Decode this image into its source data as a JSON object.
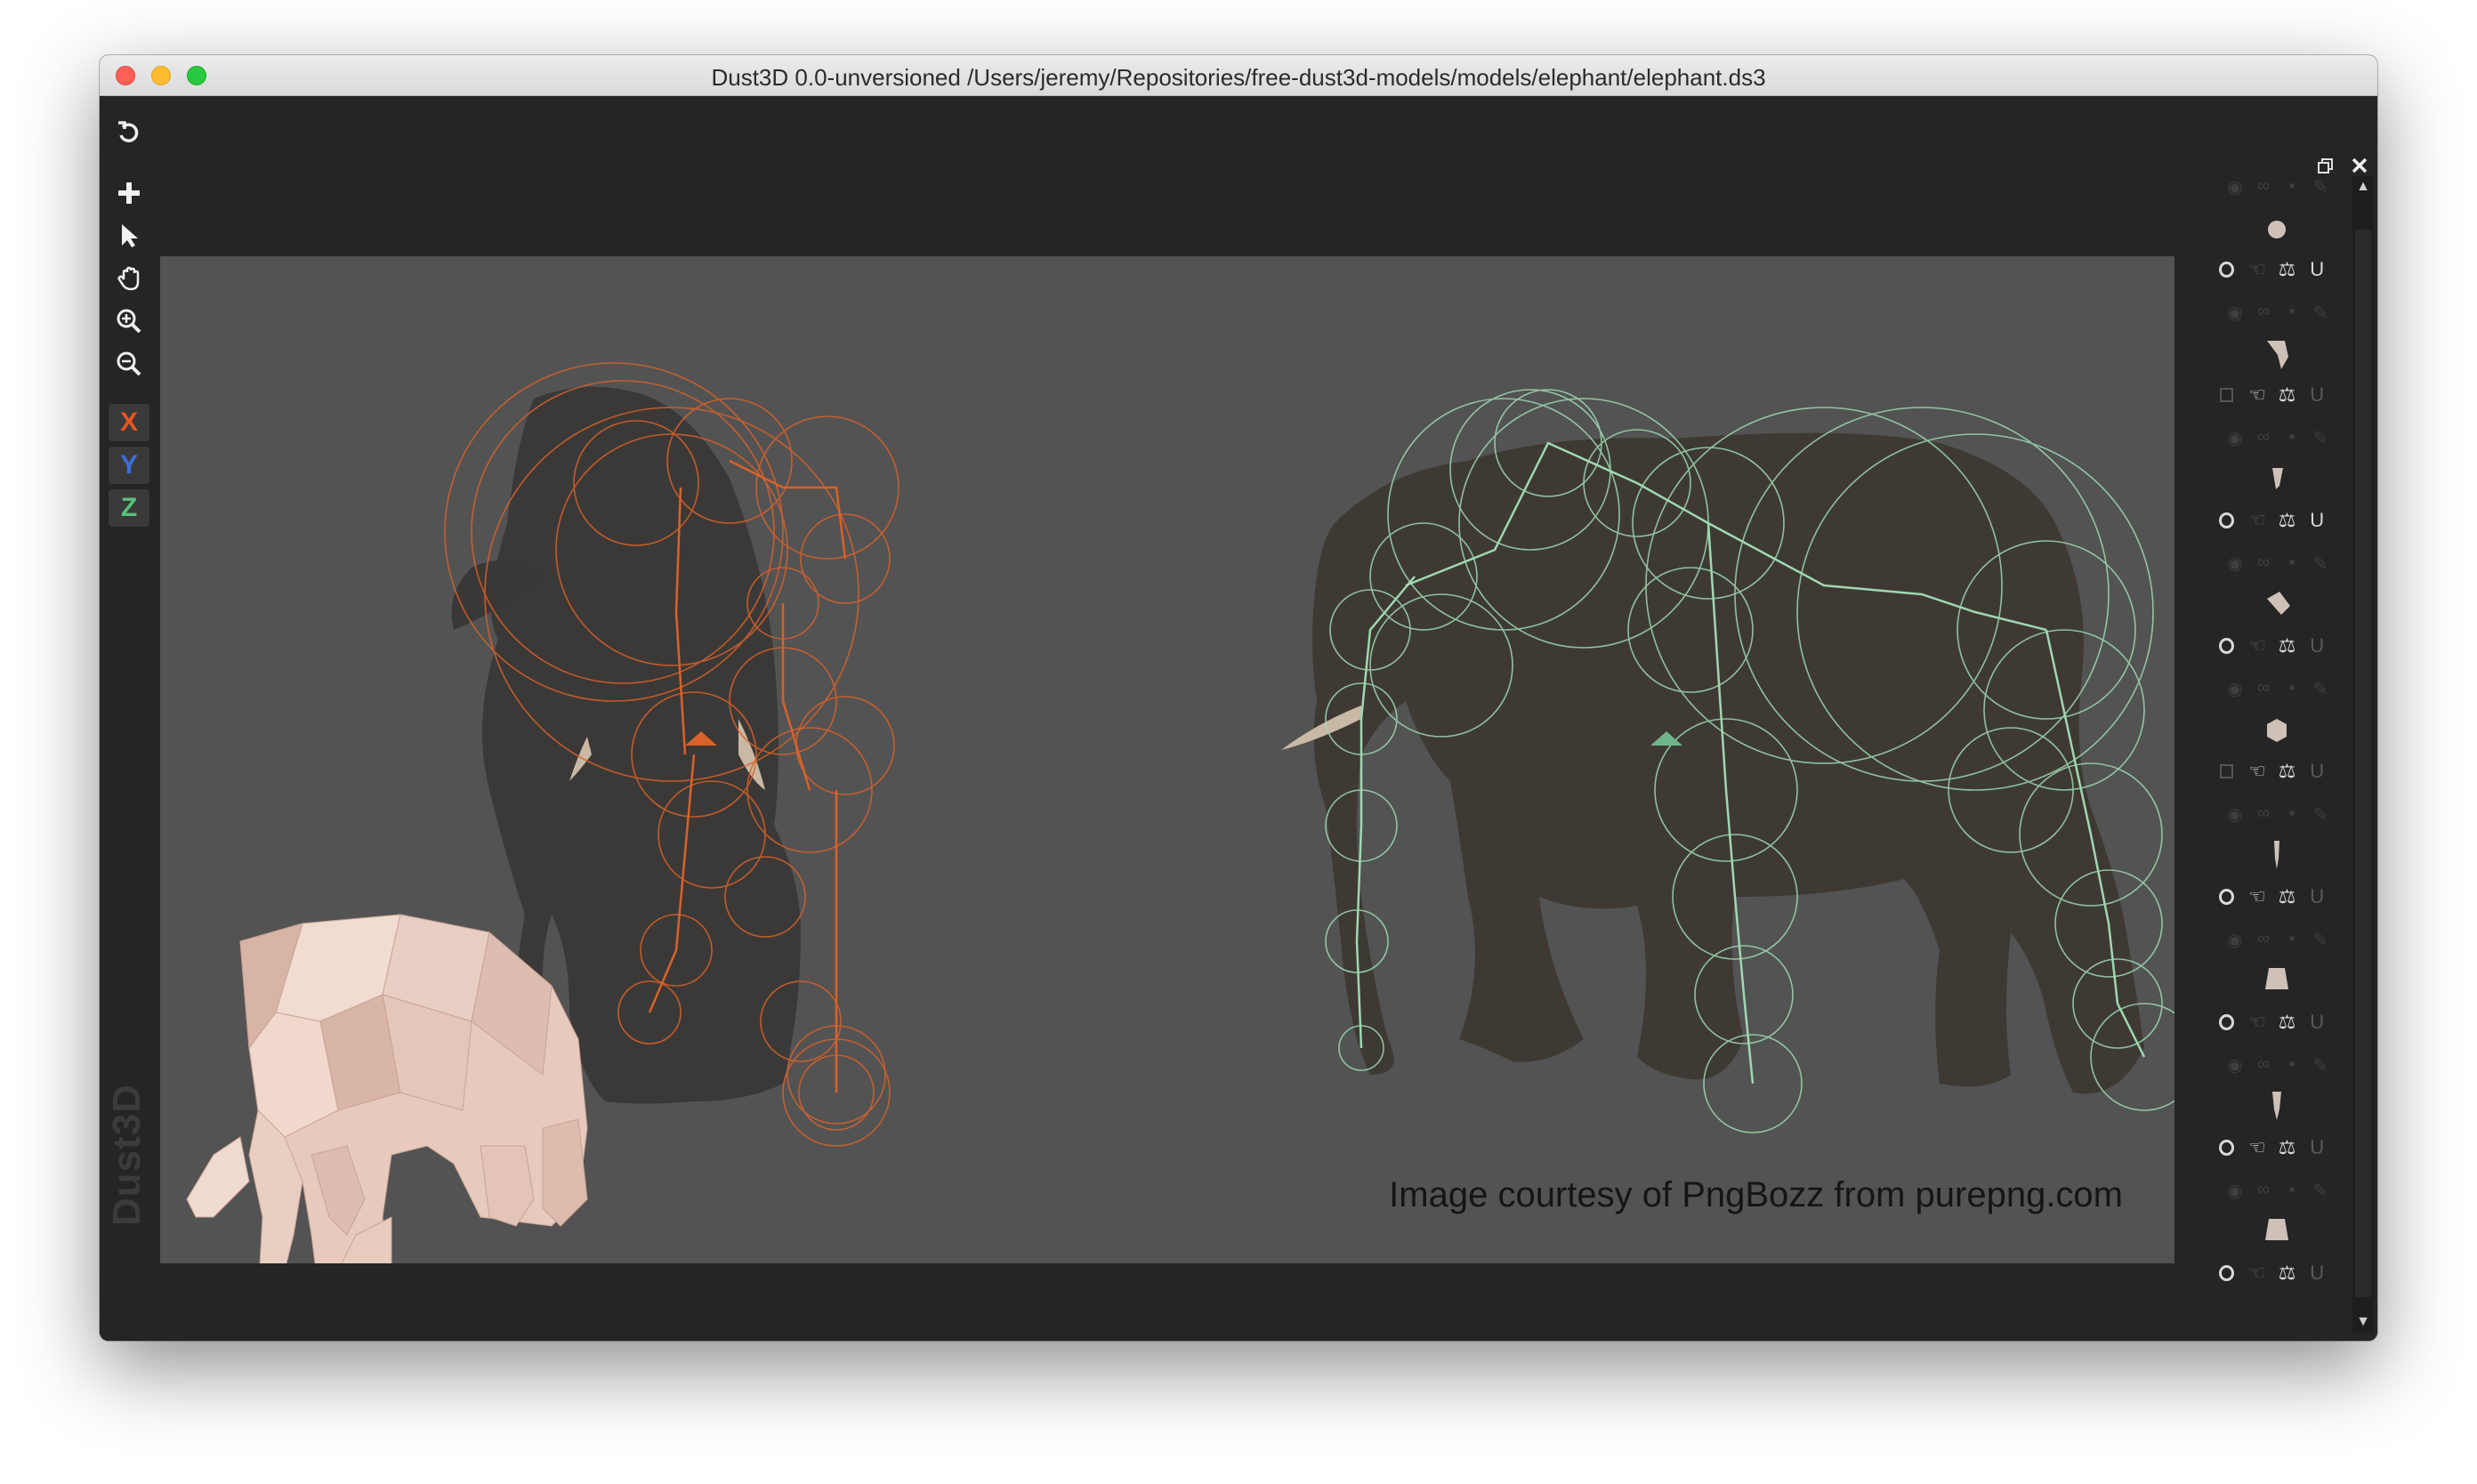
{
  "window": {
    "title": "Dust3D 0.0-unversioned /Users/jeremy/Repositories/free-dust3d-models/models/elephant/elephant.ds3"
  },
  "toolbar": {
    "undo_icon": "undo-icon",
    "add_icon": "plus-icon",
    "select_icon": "pointer-icon",
    "pan_icon": "hand-icon",
    "zoom_in_icon": "zoom-in-icon",
    "zoom_out_icon": "zoom-out-icon",
    "x_label": "X",
    "y_label": "Y",
    "z_label": "Z",
    "colors": {
      "x": "#e8551f",
      "y": "#3a6fd8",
      "z": "#55c27a"
    }
  },
  "brand": {
    "text": "Dust3D"
  },
  "canvas": {
    "credit": "Image courtesy of PngBozz from purepng.com",
    "front_view_color": "#d8622a",
    "side_view_color": "#8fcfa6",
    "model_color": "#e6c5b6"
  },
  "parts_panel": {
    "parts": [
      {
        "thumb": "sphere",
        "selector": "radio",
        "mirror": false,
        "magnet": true
      },
      {
        "thumb": "ear",
        "selector": "checkbox",
        "mirror": true,
        "magnet": false
      },
      {
        "thumb": "tusk",
        "selector": "radio",
        "mirror": false,
        "magnet": true
      },
      {
        "thumb": "block",
        "selector": "radio",
        "mirror": false,
        "magnet": false
      },
      {
        "thumb": "hex",
        "selector": "checkbox",
        "mirror": true,
        "magnet": false
      },
      {
        "thumb": "trunk",
        "selector": "radio",
        "mirror": true,
        "magnet": false
      },
      {
        "thumb": "foot",
        "selector": "radio",
        "mirror": false,
        "magnet": false
      },
      {
        "thumb": "leg",
        "selector": "radio",
        "mirror": true,
        "magnet": false
      },
      {
        "thumb": "foot",
        "selector": "radio",
        "mirror": false,
        "magnet": false
      }
    ]
  }
}
